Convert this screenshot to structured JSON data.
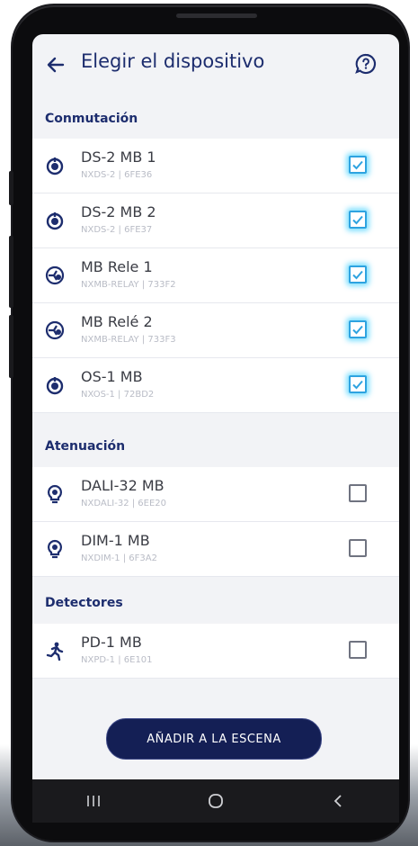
{
  "app": {
    "title": "Elegir el dispositivo"
  },
  "colors": {
    "accent": "#1d2d6e",
    "checkbox_on": "#2ea3e0",
    "button": "#141f55"
  },
  "sections": [
    {
      "label": "Conmutación",
      "devices": [
        {
          "name": "DS-2 MB 1",
          "sub": "NXDS-2 | 6FE36",
          "icon": "power-icon",
          "checked": true
        },
        {
          "name": "DS-2 MB 2",
          "sub": "NXDS-2 | 6FE37",
          "icon": "power-icon",
          "checked": true
        },
        {
          "name": "MB Rele 1",
          "sub": "NXMB-RELAY | 733F2",
          "icon": "relay-icon",
          "checked": true
        },
        {
          "name": "MB Relé 2",
          "sub": "NXMB-RELAY | 733F3",
          "icon": "relay-icon",
          "checked": true
        },
        {
          "name": "OS-1 MB",
          "sub": "NXOS-1 | 72BD2",
          "icon": "power-icon",
          "checked": true
        }
      ]
    },
    {
      "label": "Atenuación",
      "devices": [
        {
          "name": "DALI-32 MB",
          "sub": "NXDALI-32 | 6EE20",
          "icon": "bulb-icon",
          "checked": false
        },
        {
          "name": "DIM-1 MB",
          "sub": "NXDIM-1 | 6F3A2",
          "icon": "bulb-icon",
          "checked": false
        }
      ]
    },
    {
      "label": "Detectores",
      "devices": [
        {
          "name": "PD-1 MB",
          "sub": "NXPD-1 | 6E101",
          "icon": "motion-icon",
          "checked": false
        }
      ]
    }
  ],
  "actions": {
    "add_label": "AÑADIR A LA ESCENA"
  }
}
